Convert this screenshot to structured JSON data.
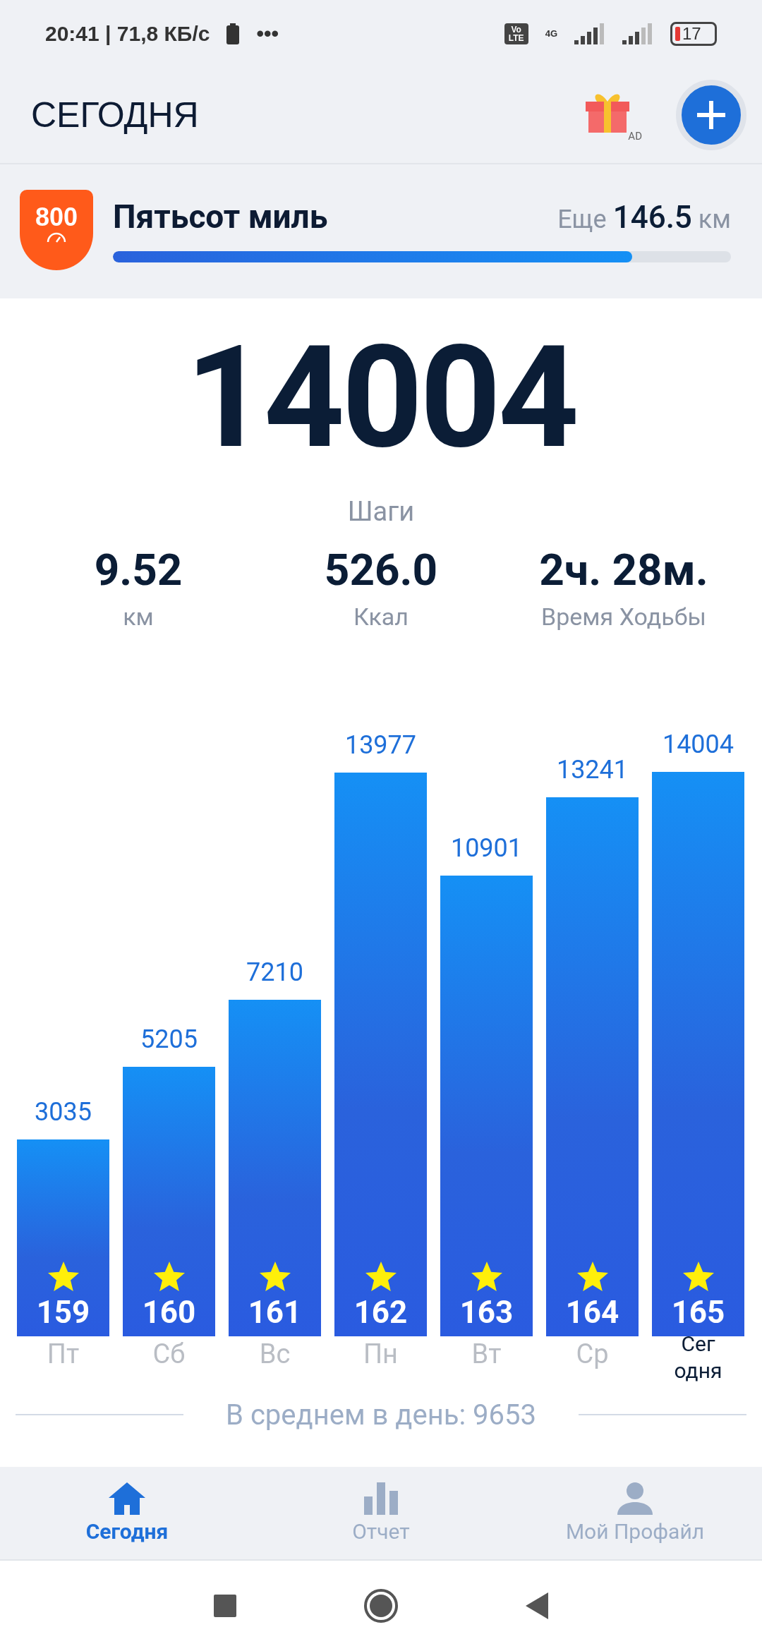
{
  "status_bar": {
    "time_speed": "20:41 | 71,8 КБ/с",
    "dots": "•••",
    "volte": "Vo LTE",
    "network": "4G",
    "battery": "17"
  },
  "header": {
    "title": "СЕГОДНЯ",
    "ad_label": "AD"
  },
  "challenge": {
    "badge": "800",
    "title": "Пятьсот миль",
    "remaining_prefix": "Еще",
    "remaining_value": "146.5",
    "remaining_unit": "км",
    "level": 0.84
  },
  "steps": {
    "value": "14004",
    "label": "Шаги"
  },
  "stats": [
    {
      "value": "9.52",
      "label": "км"
    },
    {
      "value": "526.0",
      "label": "Ккал"
    },
    {
      "value": "2ч. 28м.",
      "label": "Время Ходьбы"
    }
  ],
  "days": [
    {
      "label": "Пт",
      "steps": "3035",
      "count": "159",
      "selected": false
    },
    {
      "label": "Сб",
      "steps": "5205",
      "count": "160",
      "selected": false
    },
    {
      "label": "Вс",
      "steps": "7210",
      "count": "161",
      "selected": false
    },
    {
      "label": "Пн",
      "steps": "13977",
      "count": "162",
      "selected": false
    },
    {
      "label": "Вт",
      "steps": "10901",
      "count": "163",
      "selected": false
    },
    {
      "label": "Ср",
      "steps": "13241",
      "count": "164",
      "selected": false
    },
    {
      "label": "Сег одня",
      "steps": "14004",
      "count": "165",
      "selected": true
    }
  ],
  "average": "В среднем в день: 9653",
  "nav": [
    {
      "label": "Сегодня",
      "kind": "home",
      "selected": true
    },
    {
      "label": "Отчет",
      "kind": "report",
      "selected": false
    },
    {
      "label": "Мой Профайл",
      "kind": "profile",
      "selected": false
    }
  ]
}
